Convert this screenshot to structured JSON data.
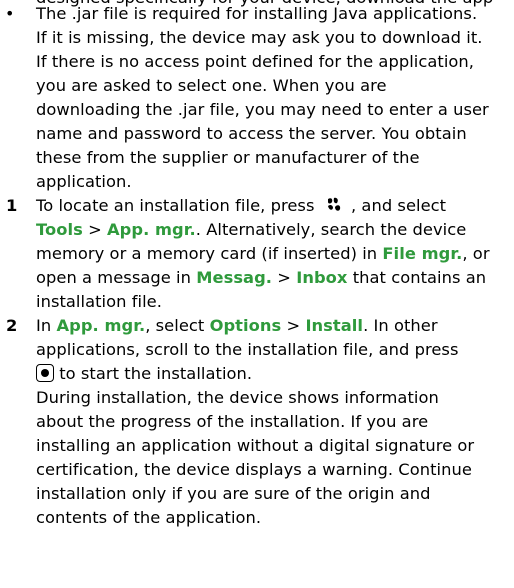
{
  "top_fragment": "designed specifically for your device, download the app",
  "bullet": {
    "marker": "•",
    "lines": [
      "The .jar file is required for installing Java applications.",
      "If it is missing, the device may ask you to download it.",
      "If there is no access point defined for the application,",
      "you are asked to select one. When you are",
      "downloading the .jar file, you may need to enter a user",
      "name and password to access the server. You obtain",
      "these from the supplier or manufacturer of the",
      "application."
    ]
  },
  "step1": {
    "number": "1",
    "l1_a": "To locate an installation file, press",
    "l1_b": ", and select",
    "tools": "Tools",
    "gt": ">",
    "app_mgr": "App. mgr.",
    "l2_c": ". Alternatively, search the device",
    "l3": "memory or a memory card (if inserted) in",
    "file_mgr": "File mgr.",
    "l3_end": ", or",
    "l4_a": "open a message in",
    "messag": "Messag.",
    "inbox": "Inbox",
    "l4_b": "that contains an",
    "l5": "installation file.",
    "menu_icon": "menu-key-icon"
  },
  "step2": {
    "number": "2",
    "l1_a": "In",
    "app_mgr": "App. mgr.",
    "l1_b": ", select",
    "options": "Options",
    "gt": ">",
    "install": "Install",
    "l1_c": ". In other",
    "l2": "applications, scroll to the installation file, and press",
    "l3": "to start the installation.",
    "select_icon": "scroll-key-icon",
    "para": [
      "During installation, the device shows information",
      "about the progress of the installation. If you are",
      "installing an application without a digital signature or",
      "certification, the device displays a warning. Continue",
      "installation only if you are sure of the origin and",
      "contents of the application."
    ]
  },
  "colors": {
    "text": "#000000",
    "highlight": "#2f9a3c",
    "background": "#ffffff"
  }
}
